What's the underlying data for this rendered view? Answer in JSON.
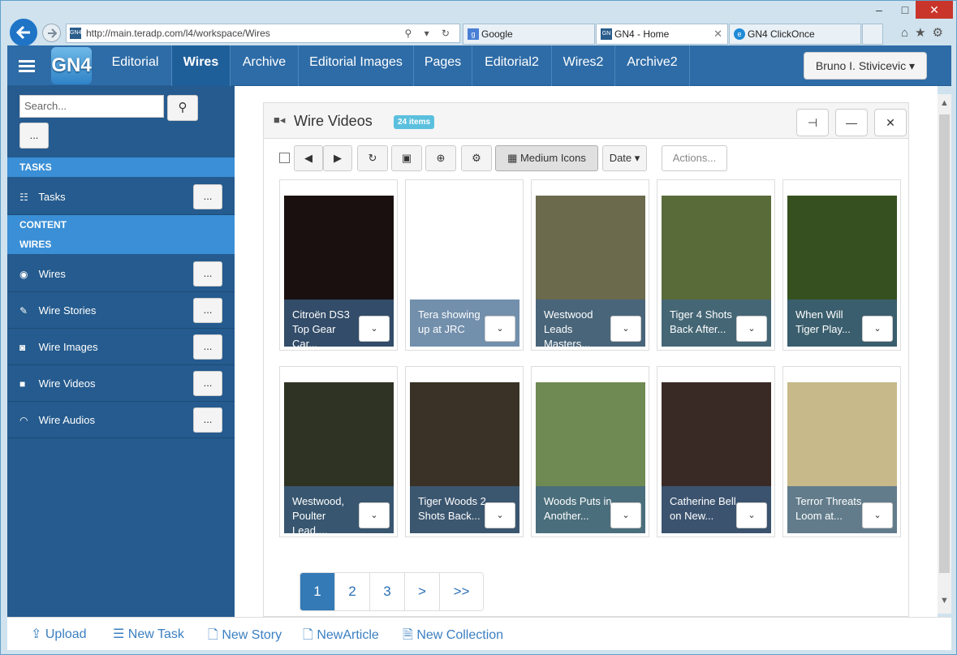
{
  "browser": {
    "url": "http://main.teradp.com/l4/workspace/Wires",
    "url_tools": "⚲ ▾ ↻",
    "tabs": [
      {
        "label": "Google",
        "icon": "g"
      },
      {
        "label": "GN4 - Home",
        "icon": "GN"
      },
      {
        "label": "GN4 ClickOnce",
        "icon": "e"
      }
    ],
    "tab_close": "✕",
    "window_controls": {
      "minimize": "–",
      "maximize": "□",
      "close": "✕"
    },
    "right_icons": "⌂★⚙"
  },
  "app": {
    "logo": "GN4",
    "nav": [
      "Editorial",
      "Wires",
      "Archive",
      "Editorial Images",
      "Pages",
      "Editorial2",
      "Wires2",
      "Archive2"
    ],
    "active_nav": "Wires",
    "user": "Bruno I. Stivicevic ▾"
  },
  "sidebar": {
    "search_placeholder": "Search...",
    "search_icon": "⚲",
    "more_button": "...",
    "sections": {
      "tasks": "TASKS",
      "content": "CONTENT",
      "wires": "WIRES"
    },
    "task_items": [
      {
        "label": "Tasks",
        "icon": "☷",
        "more": "..."
      }
    ],
    "wire_items": [
      {
        "label": "Wires",
        "icon": "◉",
        "more": "..."
      },
      {
        "label": "Wire Stories",
        "icon": "✎",
        "more": "..."
      },
      {
        "label": "Wire Images",
        "icon": "◙",
        "more": "..."
      },
      {
        "label": "Wire Videos",
        "icon": "■",
        "more": "..."
      },
      {
        "label": "Wire Audios",
        "icon": "◠",
        "more": "..."
      }
    ]
  },
  "panel": {
    "title": "Wire Videos",
    "title_icon": "■◂",
    "badge": "24 items",
    "header_buttons": {
      "pin": "⊣",
      "minimize": "—",
      "close": "✕"
    },
    "toolbar": {
      "back": "◀",
      "forward": "▶",
      "refresh": "↻",
      "save": "▣",
      "zoom": "⊕",
      "settings": "⚙",
      "view": "▦ Medium Icons",
      "sort": "Date ▾",
      "actions": "Actions..."
    },
    "items": [
      {
        "caption": "Citroën DS3 Top Gear Car...",
        "color": "#1a1010"
      },
      {
        "caption": "Tera showing up at JRC",
        "color": "#ffffff"
      },
      {
        "caption": "Westwood Leads Masters...",
        "color": "#6b6a4c"
      },
      {
        "caption": "Tiger 4 Shots Back After...",
        "color": "#5a6b3a"
      },
      {
        "caption": "When Will Tiger Play...",
        "color": "#36511f"
      },
      {
        "caption": "Westwood, Poulter Lead,...",
        "color": "#2f3324"
      },
      {
        "caption": "Tiger Woods 2 Shots Back...",
        "color": "#3a3226"
      },
      {
        "caption": "Woods Puts in Another...",
        "color": "#6f8a52"
      },
      {
        "caption": "Catherine Bell on New...",
        "color": "#3a2a26"
      },
      {
        "caption": "Terror Threats Loom at...",
        "color": "#c7b98a"
      }
    ],
    "caption_button": "⌄",
    "pager": [
      "1",
      "2",
      "3",
      ">",
      ">>"
    ],
    "current_page": "1"
  },
  "bottom_links": [
    {
      "label": "Upload",
      "icon": "⇪"
    },
    {
      "label": "New Task",
      "icon": "☰"
    },
    {
      "label": "New Story",
      "icon": "🗋"
    },
    {
      "label": "NewArticle",
      "icon": "🗋"
    },
    {
      "label": "New Collection",
      "icon": "🗎"
    }
  ]
}
